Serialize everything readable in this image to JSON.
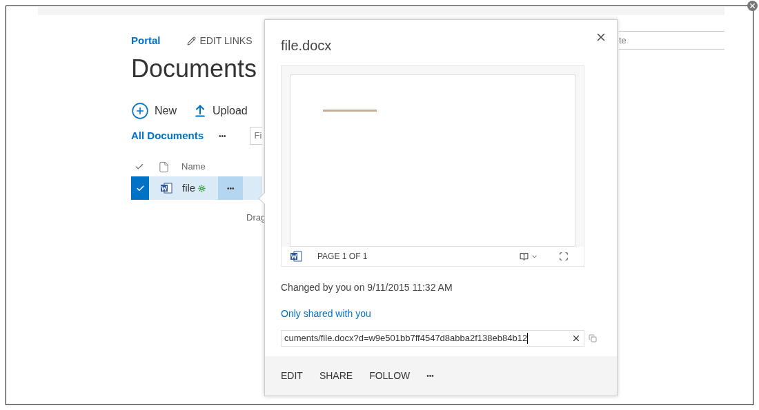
{
  "page": {
    "nav_link": "Portal",
    "edit_links": "EDIT LINKS",
    "title": "Documents",
    "search": {
      "placeholder": "te"
    },
    "commands": [
      {
        "label": "New",
        "kind": "new"
      },
      {
        "label": "Upload",
        "kind": "upload"
      }
    ],
    "view": {
      "label": "All Documents",
      "more": "•••",
      "filter": {
        "placeholder": "Fi"
      }
    },
    "columns": [
      "Name"
    ],
    "rows": [
      {
        "name": "file",
        "selected": true,
        "is_new": true,
        "more": "•••"
      }
    ],
    "drop_hint": "Drag"
  },
  "callout": {
    "title": "file.docx",
    "preview": {
      "page_label": "PAGE 1 OF 1"
    },
    "changed": "Changed by you on 9/11/2015 11:32 AM",
    "sharing": "Only shared with you",
    "link": "cuments/file.docx?d=w9e501bb7ff4547d8abba2f138eb84b12",
    "actions": [
      "EDIT",
      "SHARE",
      "FOLLOW",
      "•••"
    ]
  }
}
